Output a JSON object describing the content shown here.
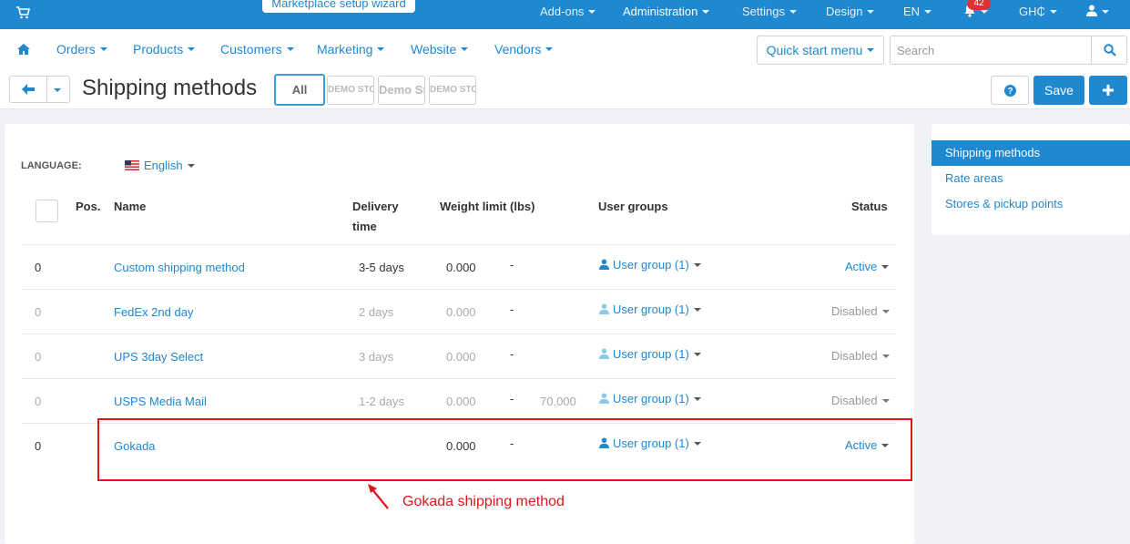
{
  "topbar": {
    "wizard_label": "Marketplace setup wizard",
    "items": [
      "Add-ons",
      "Administration",
      "Settings",
      "Design",
      "EN",
      "GH₵"
    ],
    "notifications_count": "42"
  },
  "nav": {
    "items": [
      "Orders",
      "Products",
      "Customers",
      "Marketing",
      "Website",
      "Vendors"
    ],
    "quick_start_label": "Quick start menu",
    "search_placeholder": "Search"
  },
  "toolbar": {
    "title": "Shipping methods",
    "stores": [
      "All",
      "DEMO STORE",
      "Demo Sto",
      "DEMO STORE"
    ],
    "save_label": "Save"
  },
  "language": {
    "label": "LANGUAGE:",
    "value": "English"
  },
  "table": {
    "headers": {
      "pos": "Pos.",
      "name": "Name",
      "delivery_line1": "Delivery",
      "delivery_line2": "time",
      "weight": "Weight limit (lbs)",
      "user_groups": "User groups",
      "status": "Status"
    },
    "rows": [
      {
        "pos": "0",
        "name": "Custom shipping method",
        "delivery": "3-5 days",
        "weight_min": "0.000",
        "dash": "-",
        "weight_max": "",
        "user_group": "User group (1)",
        "status": "Active"
      },
      {
        "pos": "0",
        "name": "FedEx 2nd day",
        "delivery": "2 days",
        "weight_min": "0.000",
        "dash": "-",
        "weight_max": "",
        "user_group": "User group (1)",
        "status": "Disabled"
      },
      {
        "pos": "0",
        "name": "UPS 3day Select",
        "delivery": "3 days",
        "weight_min": "0.000",
        "dash": "-",
        "weight_max": "",
        "user_group": "User group (1)",
        "status": "Disabled"
      },
      {
        "pos": "0",
        "name": "USPS Media Mail",
        "delivery": "1-2 days",
        "weight_min": "0.000",
        "dash": "-",
        "weight_max": "70.000",
        "user_group": "User group (1)",
        "status": "Disabled"
      },
      {
        "pos": "0",
        "name": "Gokada",
        "delivery": "",
        "weight_min": "0.000",
        "dash": "-",
        "weight_max": "",
        "user_group": "User group (1)",
        "status": "Active"
      }
    ]
  },
  "sidebar": {
    "items": [
      "Shipping methods",
      "Rate areas",
      "Stores & pickup points"
    ]
  },
  "annotation": {
    "text": "Gokada shipping method",
    "color": "#e0151c"
  },
  "colors": {
    "primary": "#1e88d0",
    "disabled_text": "#aaaaaa"
  }
}
